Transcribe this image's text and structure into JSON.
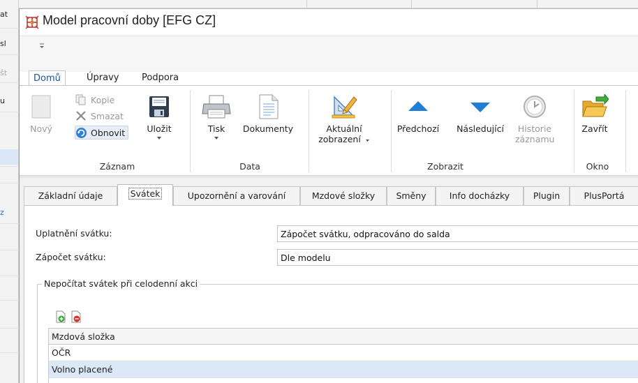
{
  "background": {
    "left_fragments": [
      "at",
      "sl",
      "št",
      "u",
      "z"
    ]
  },
  "window": {
    "title": "Model pracovní doby [EFG CZ]"
  },
  "ribbon": {
    "tabs": [
      "Domů",
      "Úpravy",
      "Podpora"
    ],
    "active_tab": "Domů",
    "buttons": {
      "novy": "Nový",
      "kopie": "Kopie",
      "smazat": "Smazat",
      "obnovit": "Obnovit",
      "ulozit": "Uložit",
      "tisk": "Tisk",
      "dokumenty": "Dokumenty",
      "aktualni_line1": "Aktuální",
      "aktualni_line2": "zobrazení",
      "predchozi": "Předchozí",
      "nasledujici": "Následující",
      "historie_line1": "Historie",
      "historie_line2": "záznamu",
      "zavrit": "Zavřít"
    },
    "groups": [
      "Záznam",
      "Data",
      "Zobrazit",
      "Okno"
    ]
  },
  "detail_tabs": [
    "Základní údaje",
    "Svátek",
    "Upozornění a varování",
    "Mzdové složky",
    "Směny",
    "Info docházky",
    "Plugin",
    "PlusPortá"
  ],
  "active_detail_tab": "Svátek",
  "form": {
    "uplatneni_label": "Uplatnění svátku:",
    "uplatneni_value": "Zápočet svátku, odpracováno do salda",
    "zapocet_label": "Zápočet svátku:",
    "zapocet_value": "Dle modelu"
  },
  "group": {
    "legend": "Nepočítat svátek při celodenní akci"
  },
  "grid": {
    "header": "Mzdová složka",
    "rows": [
      "OČR",
      "Volno placené"
    ],
    "selected_row": 1
  },
  "colors": {
    "accent": "#1a56a8",
    "selection": "#dce8f7",
    "arrow_blue": "#1f7fd6"
  }
}
